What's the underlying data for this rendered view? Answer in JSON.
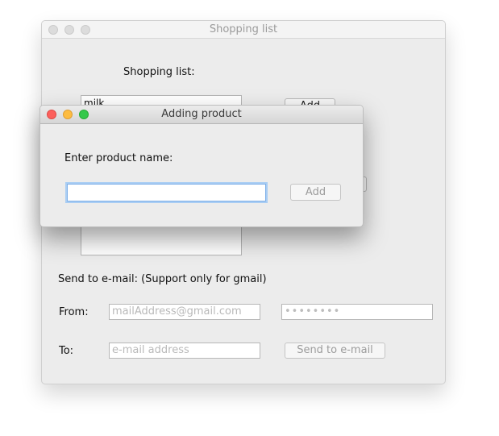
{
  "main_window": {
    "title": "Shopping list",
    "heading": "Shopping list:",
    "list_item_visible": "milk",
    "add_button_label": "Add",
    "send_label": "Send to e-mail: (Support only for gmail)",
    "from_label": "From:",
    "from_placeholder": "mailAddress@gmail.com",
    "password_value": "••••••••",
    "to_label": "To:",
    "to_placeholder": "e-mail address",
    "send_button_label": "Send to e-mail"
  },
  "dialog": {
    "title": "Adding product",
    "prompt": "Enter product name:",
    "input_value": "",
    "add_button_label": "Add"
  },
  "colors": {
    "close": "#fc605c",
    "minimize": "#fdbc40",
    "zoom": "#34c84a"
  }
}
